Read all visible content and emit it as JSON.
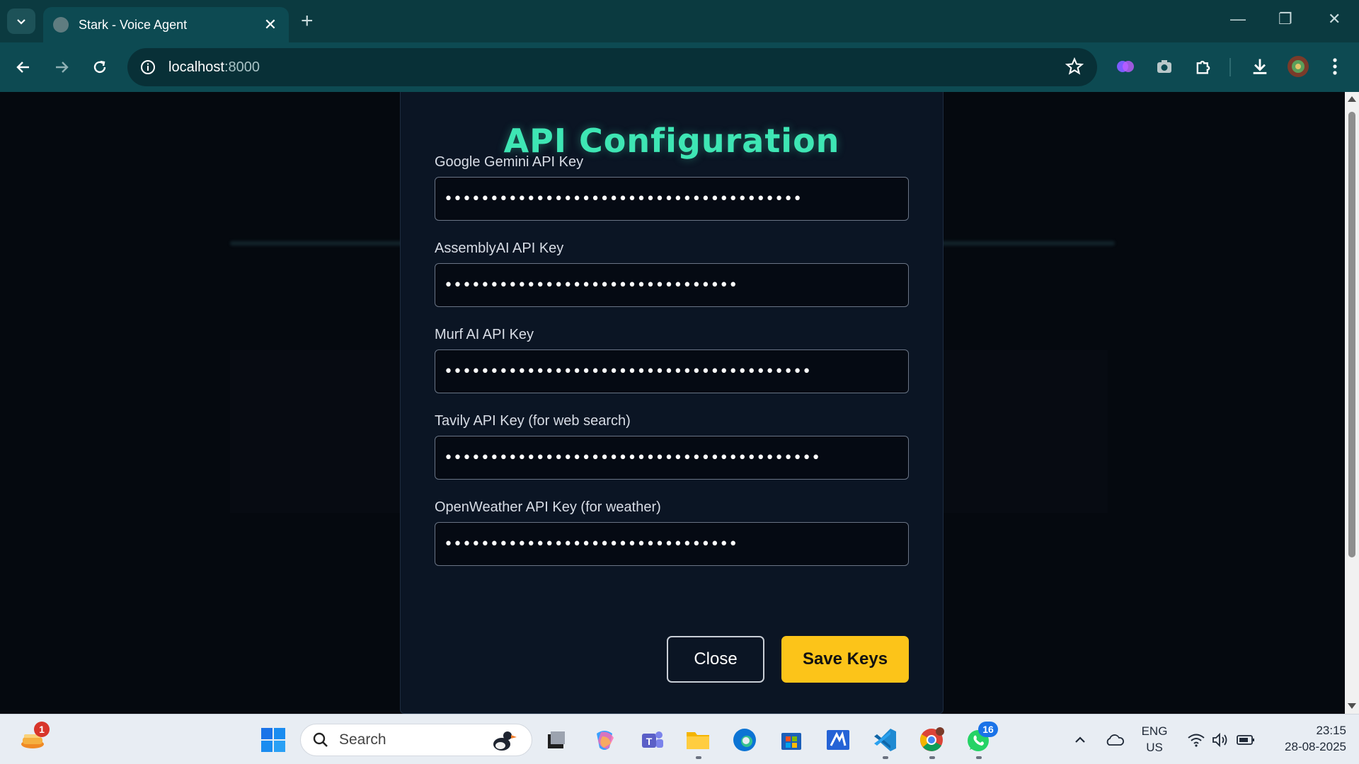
{
  "browser": {
    "tab_title": "Stark - Voice Agent",
    "url_host": "localhost",
    "url_port": ":8000"
  },
  "modal": {
    "title": "API Configuration",
    "fields": [
      {
        "label": "Google Gemini API Key",
        "value": "•••••••••••••••••••••••••••••••••••••••"
      },
      {
        "label": "AssemblyAI API Key",
        "value": "••••••••••••••••••••••••••••••••"
      },
      {
        "label": "Murf AI API Key",
        "value": "••••••••••••••••••••••••••••••••••••••••"
      },
      {
        "label": "Tavily API Key (for web search)",
        "value": "•••••••••••••••••••••••••••••••••••••••••"
      },
      {
        "label": "OpenWeather API Key (for weather)",
        "value": "••••••••••••••••••••••••••••••••"
      }
    ],
    "close_label": "Close",
    "save_label": "Save Keys"
  },
  "taskbar": {
    "search_label": "Search",
    "weather_badge": "1",
    "whatsapp_badge": "16",
    "lang_top": "ENG",
    "lang_bottom": "US",
    "time": "23:15",
    "date": "28-08-2025"
  },
  "colors": {
    "accent_title": "#3ee6b4",
    "save_button": "#fcc419",
    "chrome_teal": "#0d4a52"
  }
}
